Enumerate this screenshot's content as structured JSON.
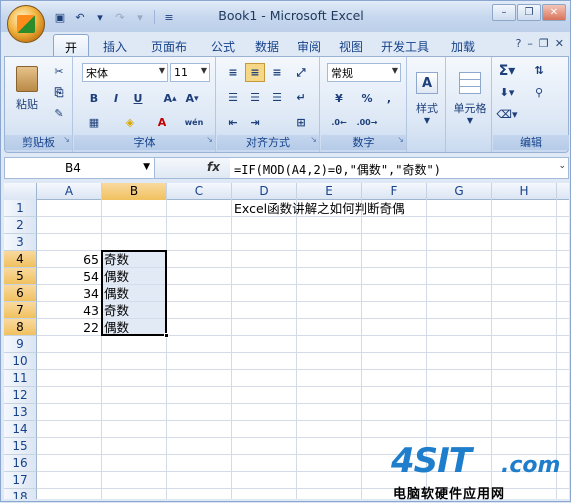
{
  "window": {
    "title": "Book1 - Microsoft Excel"
  },
  "tabs": [
    "开始",
    "插入",
    "页面布局",
    "公式",
    "数据",
    "审阅",
    "视图",
    "开发工具",
    "加载项"
  ],
  "ribbon": {
    "clipboard": {
      "label": "剪贴板",
      "paste": "粘贴"
    },
    "font": {
      "label": "字体",
      "font_name": "宋体",
      "font_size": "11"
    },
    "alignment": {
      "label": "对齐方式"
    },
    "number": {
      "label": "数字",
      "format": "常规",
      "percent": "%",
      "comma": ","
    },
    "styles": {
      "label": "样式"
    },
    "cells": {
      "label": "单元格"
    },
    "editing": {
      "label": "编辑"
    }
  },
  "formula_bar": {
    "name_box": "B4",
    "fx": "fx",
    "formula": "=IF(MOD(A4,2)=0,\"偶数\",\"奇数\")"
  },
  "columns": [
    "A",
    "B",
    "C",
    "D",
    "E",
    "F",
    "G",
    "H"
  ],
  "rows": [
    "1",
    "2",
    "3",
    "4",
    "5",
    "6",
    "7",
    "8",
    "9",
    "10",
    "11",
    "12",
    "13",
    "14",
    "15",
    "16",
    "17",
    "18"
  ],
  "cells": {
    "D1": "Excel函数讲解之如何判断奇偶",
    "A4": "65",
    "B4": "奇数",
    "A5": "54",
    "B5": "偶数",
    "A6": "34",
    "B6": "偶数",
    "A7": "43",
    "B7": "奇数",
    "A8": "22",
    "B8": "偶数"
  },
  "watermark": {
    "logo": "4SIT",
    "domain": ".com",
    "text": "电脑软硬件应用网"
  },
  "colors": {
    "accent": "#1f7ecb",
    "selection_header": "#f1c15f"
  }
}
